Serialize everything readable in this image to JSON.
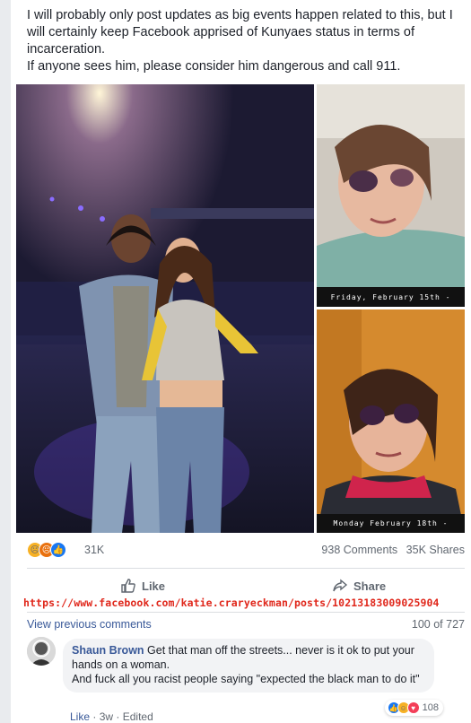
{
  "post": {
    "text_line1": "I will probably only post updates as big events happen related to this, but I will certainly keep Facebook apprised of Kunyaes status in terms of incarceration.",
    "text_line2": "If anyone sees him, please consider him dangerous and call 911."
  },
  "photos": {
    "caption_top": "Friday, February 15th -",
    "caption_bottom": "Monday February 18th -"
  },
  "reactions": {
    "icons": [
      "sad-icon",
      "angry-icon",
      "like-icon"
    ],
    "count": "31K",
    "comments": "938 Comments",
    "shares": "35K Shares"
  },
  "actions": {
    "like": "Like",
    "share": "Share"
  },
  "url": "https://www.facebook.com/katie.craryeckman/posts/10213183009025904",
  "comments_section": {
    "view_previous": "View previous comments",
    "count": "100 of 727"
  },
  "comment": {
    "author": "Shaun Brown",
    "text_line1": "Get that man off the streets... never is it ok to put your hands on a woman.",
    "text_line2": "And fuck all you racist people saying \"expected the black man to do it\"",
    "reaction_count": "108",
    "reaction_icons": [
      "like-icon",
      "haha-icon",
      "love-icon"
    ],
    "like_label": "Like",
    "time": "3w",
    "edited": "Edited"
  },
  "colors": {
    "link": "#385898",
    "secondary_text": "#606770",
    "url_red": "#e0271b",
    "like_blue": "#1877f2",
    "angry_red": "#e9710f",
    "love_red": "#f33e58",
    "sad_yellow": "#f7b125"
  }
}
